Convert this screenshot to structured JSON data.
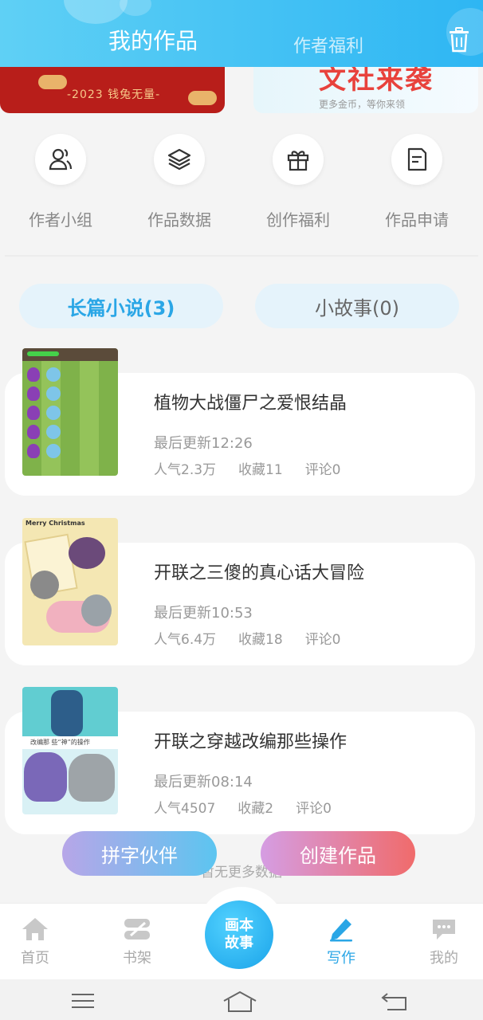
{
  "header": {
    "tab_active": "我的作品",
    "tab_inactive": "作者福利",
    "trash_icon": "trash-icon"
  },
  "banners": {
    "left_text": "-2023 钱兔无量-",
    "right_title": "文社来袭",
    "right_subtitle": "更多金币，等你来领"
  },
  "menu": [
    {
      "label": "作者小组",
      "icon": "group-icon"
    },
    {
      "label": "作品数据",
      "icon": "layers-icon"
    },
    {
      "label": "创作福利",
      "icon": "gift-icon"
    },
    {
      "label": "作品申请",
      "icon": "document-icon"
    }
  ],
  "categories": [
    {
      "label": "长篇小说(3)",
      "active": true
    },
    {
      "label": "小故事(0)",
      "active": false
    }
  ],
  "works": [
    {
      "title": "植物大战僵尸之爱恨结晶",
      "updated": "最后更新12:26",
      "popularity": "人气2.3万",
      "favorites": "收藏11",
      "comments": "评论0"
    },
    {
      "title": "开联之三傻的真心话大冒险",
      "updated": "最后更新10:53",
      "popularity": "人气6.4万",
      "favorites": "收藏18",
      "comments": "评论0"
    },
    {
      "title": "开联之穿越改编那些操作",
      "updated": "最后更新08:14",
      "popularity": "人气4507",
      "favorites": "收藏2",
      "comments": "评论0"
    }
  ],
  "thumbs": {
    "merry": "Merry Christmas",
    "caption3": "改编那 些“神”的操作"
  },
  "actions": {
    "left": "拼字伙伴",
    "right": "创建作品",
    "no_more": "暂无更多数据"
  },
  "nav": {
    "home": "首页",
    "shelf": "书架",
    "center_line1": "画本",
    "center_line2": "故事",
    "write": "写作",
    "mine": "我的"
  },
  "colors": {
    "accent": "#2aa6e6",
    "header_start": "#5fd0f5",
    "header_end": "#2eb6f3"
  }
}
